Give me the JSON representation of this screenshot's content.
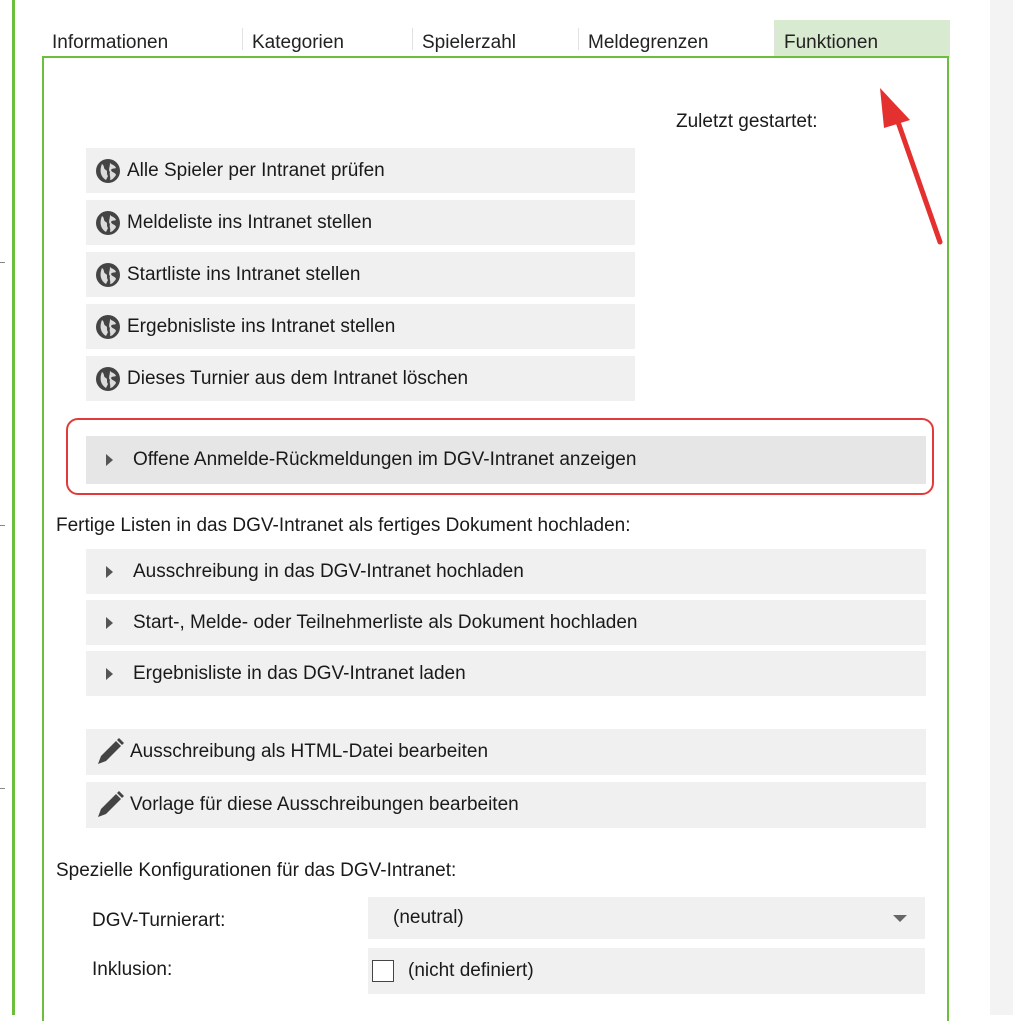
{
  "tabs": [
    {
      "label": "Informationen",
      "active": false
    },
    {
      "label": "Kategorien",
      "active": false
    },
    {
      "label": "Spielerzahl",
      "active": false
    },
    {
      "label": "Meldegrenzen",
      "active": false
    },
    {
      "label": "Funktionen",
      "active": true
    }
  ],
  "last_started_label": "Zuletzt gestartet:",
  "intranet_actions": [
    {
      "label": "Alle Spieler per Intranet prüfen",
      "icon": "globe-icon"
    },
    {
      "label": "Meldeliste ins Intranet stellen",
      "icon": "globe-icon"
    },
    {
      "label": "Startliste ins Intranet stellen",
      "icon": "globe-icon"
    },
    {
      "label": "Ergebnisliste ins Intranet stellen",
      "icon": "globe-icon"
    },
    {
      "label": "Dieses Turnier aus dem Intranet löschen",
      "icon": "globe-icon"
    }
  ],
  "highlighted_action": {
    "label": "Offene Anmelde-Rückmeldungen im DGV-Intranet anzeigen",
    "icon": "play-triangle-icon"
  },
  "upload_section": {
    "title": "Fertige Listen in das DGV-Intranet als fertiges Dokument hochladen:",
    "items": [
      {
        "label": "Ausschreibung in das DGV-Intranet hochladen"
      },
      {
        "label": "Start-, Melde- oder Teilnehmerliste als Dokument hochladen"
      },
      {
        "label": "Ergebnisliste in das DGV-Intranet laden"
      }
    ]
  },
  "edit_actions": [
    {
      "label": "Ausschreibung als HTML-Datei bearbeiten",
      "icon": "pencil-icon"
    },
    {
      "label": "Vorlage für diese Ausschreibungen bearbeiten",
      "icon": "pencil-icon"
    }
  ],
  "config_section": {
    "title": "Spezielle Konfigurationen für das DGV-Intranet:",
    "tournament_type_label": "DGV-Turnierart:",
    "tournament_type_value": "(neutral)",
    "inclusion_label": "Inklusion:",
    "inclusion_value": "(nicht definiert)",
    "inclusion_checked": false
  },
  "colors": {
    "accent_green": "#6cbf3c",
    "active_tab_bg": "#d8ebd0",
    "highlight_red": "#e23a3a",
    "button_bg": "#f0f0f0"
  }
}
